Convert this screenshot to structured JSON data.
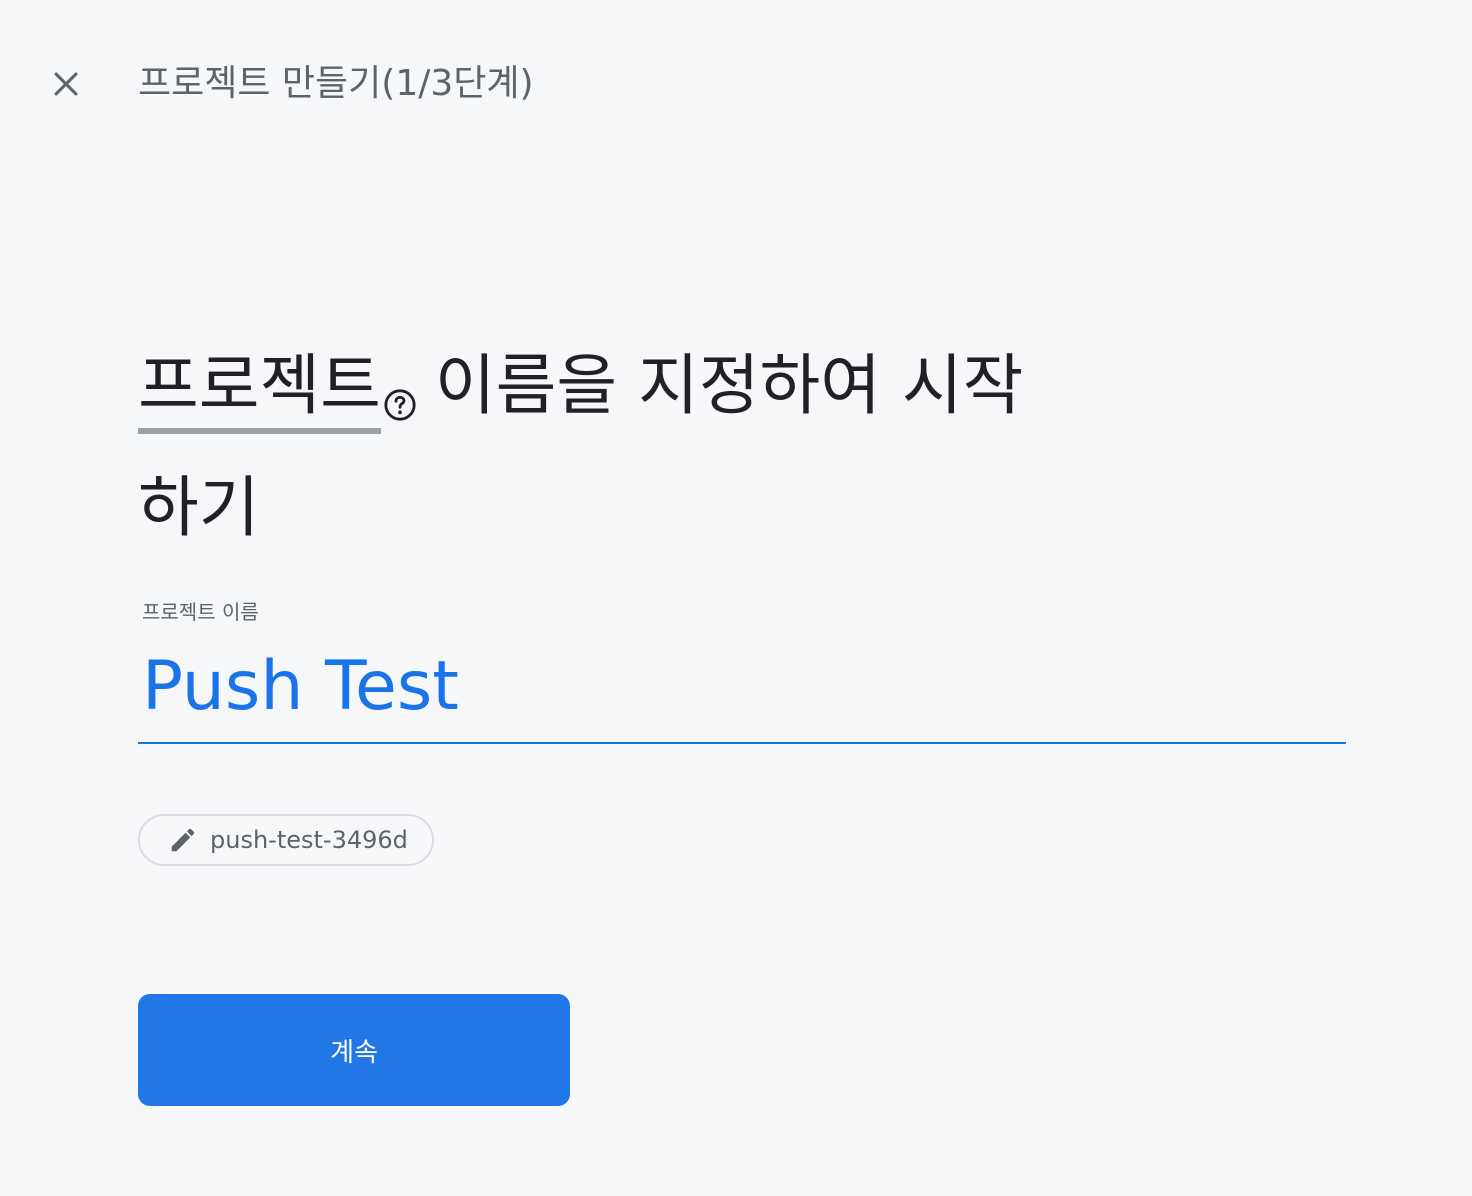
{
  "header": {
    "close_icon": "close-icon",
    "title": "프로젝트 만들기(1/3단계)"
  },
  "headline": {
    "term": "프로젝트",
    "help_icon": "help-circle-icon",
    "rest_line1": "이름을 지정하여 시작",
    "rest_line2": "하기"
  },
  "project_name_field": {
    "label": "프로젝트 이름",
    "value": "Push Test"
  },
  "project_id_chip": {
    "icon": "pencil-icon",
    "text": "push-test-3496d"
  },
  "continue_button": {
    "label": "계속"
  },
  "colors": {
    "background": "#f6f7f9",
    "accent": "#1a73e8",
    "button": "#2277e6",
    "muted_text": "#5f6368"
  }
}
